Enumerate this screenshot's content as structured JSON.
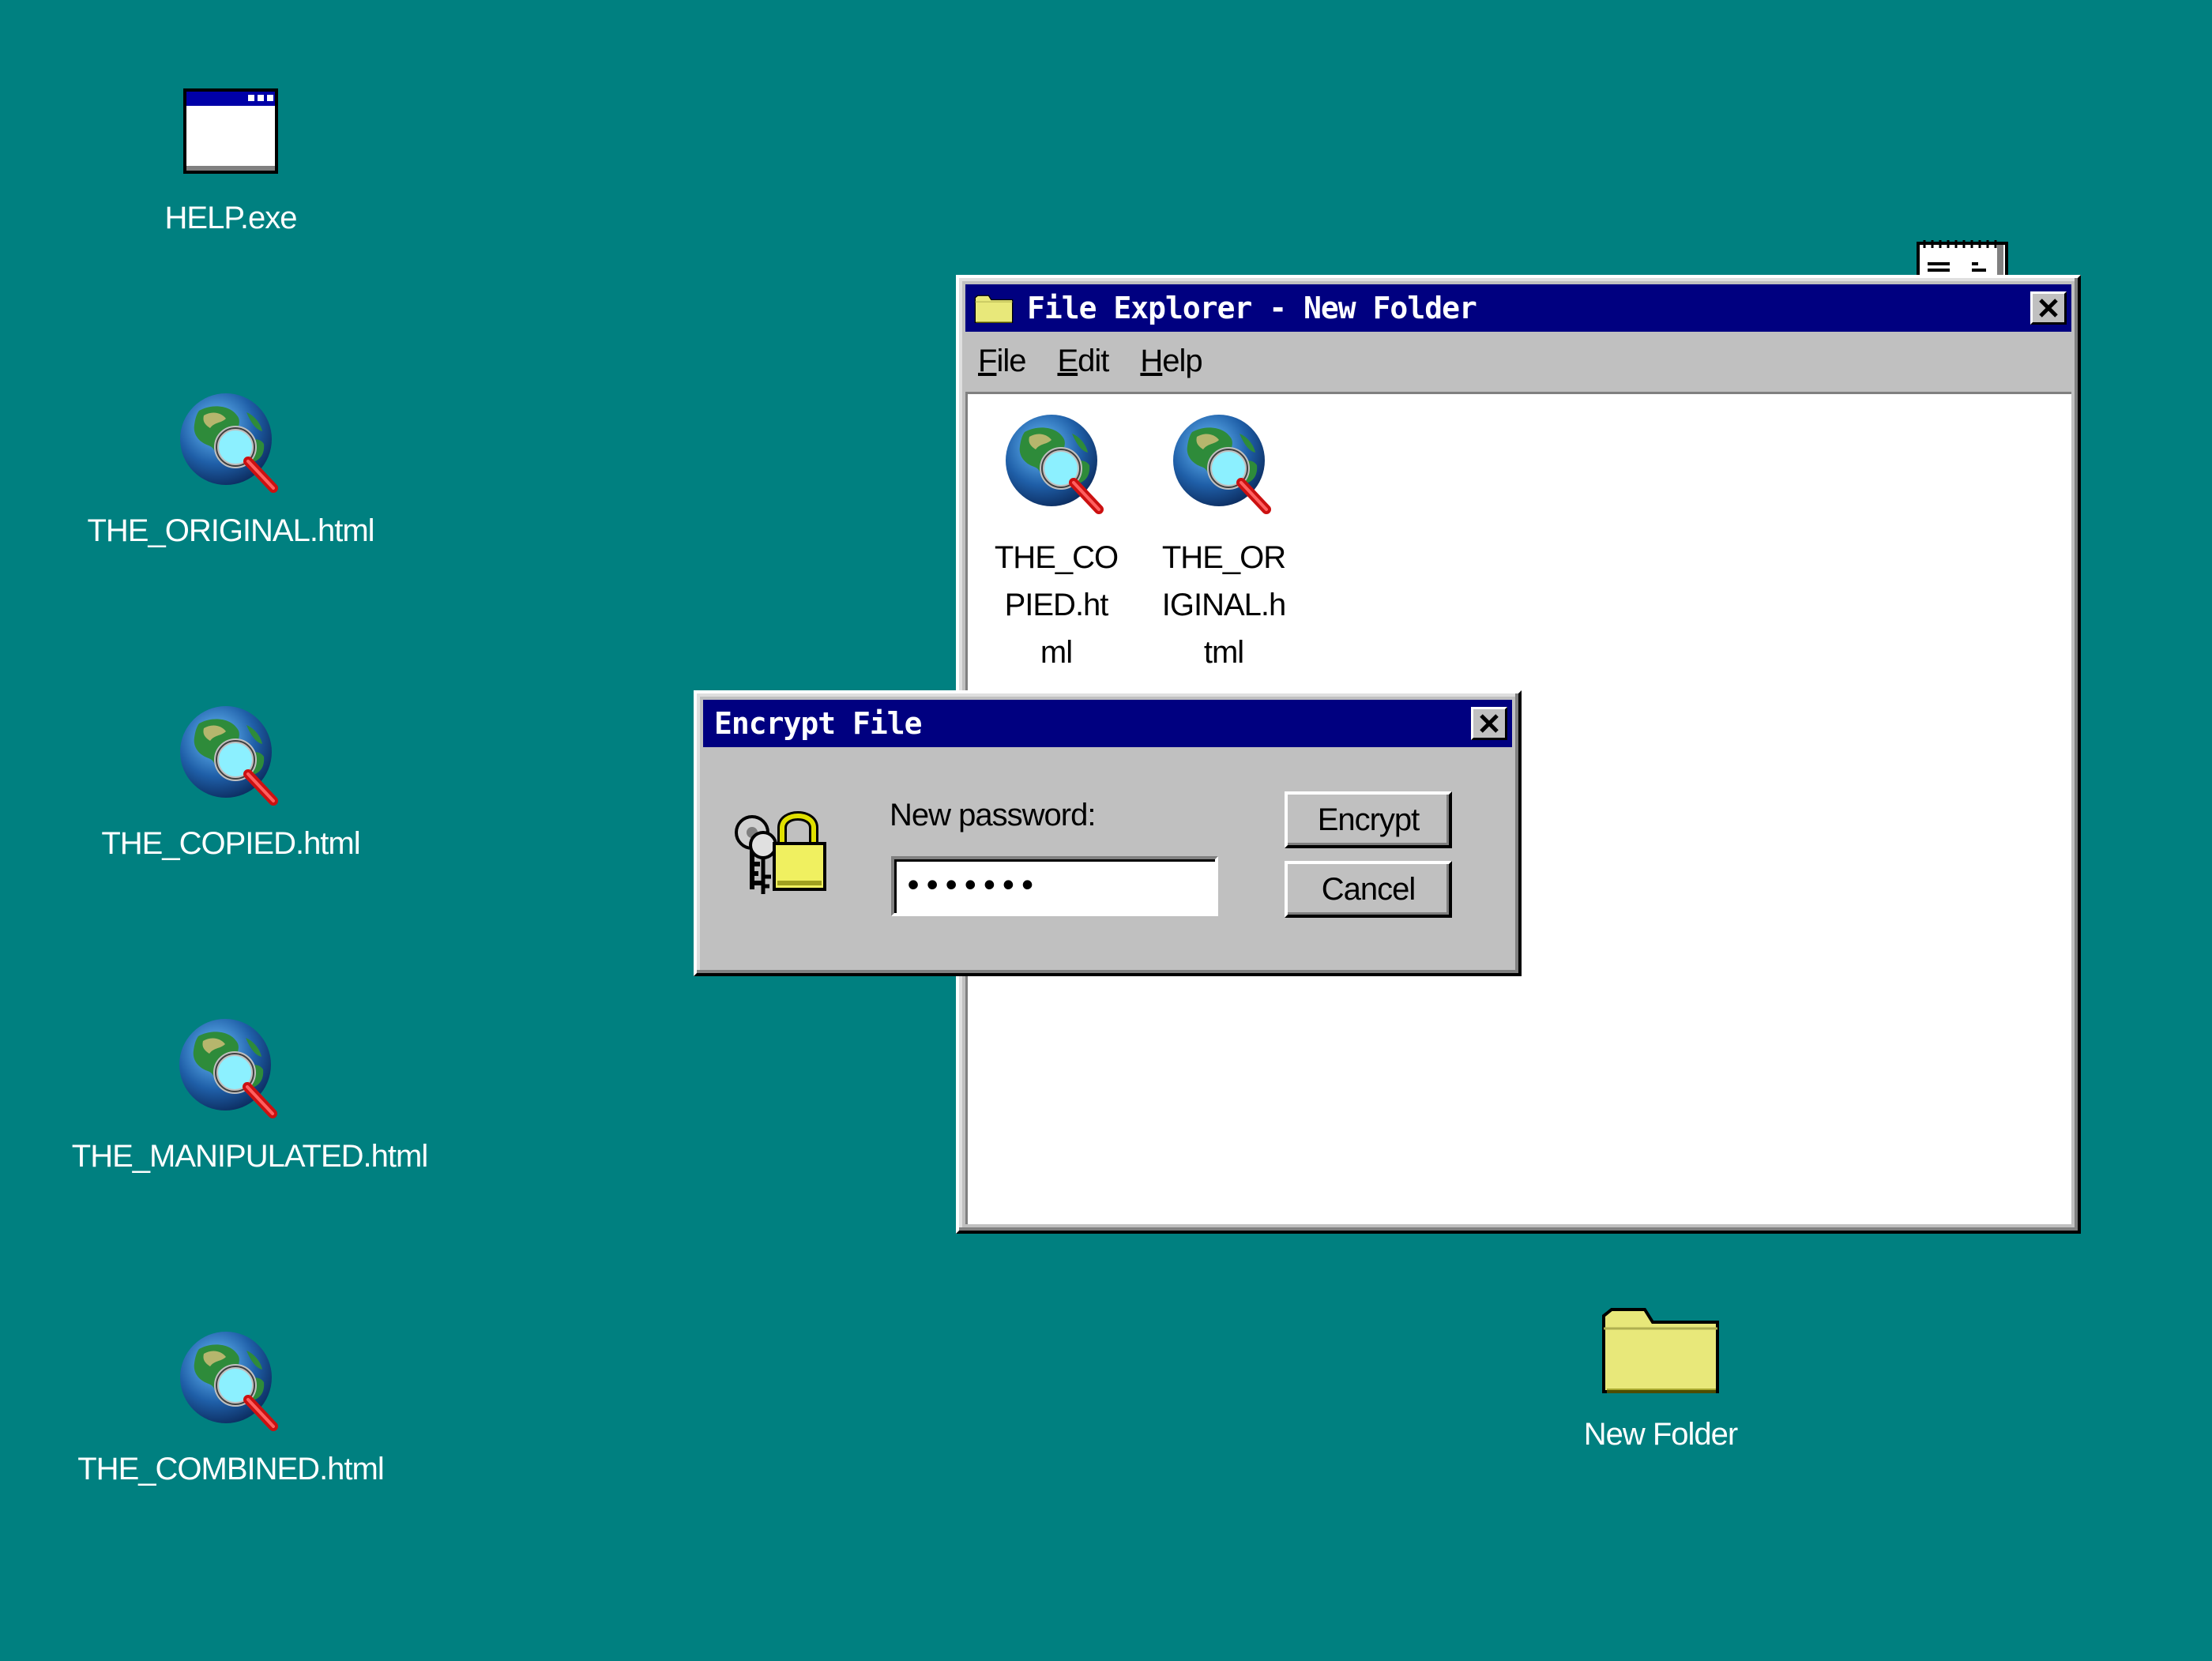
{
  "desktop": {
    "background_color": "#008080",
    "icons": [
      {
        "label": "HELP.exe",
        "icon": "window-app-icon"
      },
      {
        "label": "THE_ORIGINAL.html",
        "icon": "globe-magnifier-icon"
      },
      {
        "label": "THE_COPIED.html",
        "icon": "globe-magnifier-icon"
      },
      {
        "label": "THE_MANIPULATED.html",
        "icon": "globe-magnifier-icon"
      },
      {
        "label": "THE_COMBINED.html",
        "icon": "globe-magnifier-icon"
      },
      {
        "label": "New Folder",
        "icon": "folder-icon"
      }
    ]
  },
  "explorer": {
    "title": "File Explorer - New Folder",
    "title_icon": "folder-icon",
    "menu": [
      "File",
      "Edit",
      "Help"
    ],
    "files": [
      {
        "label": "THE_COPIED.html",
        "icon": "globe-magnifier-icon"
      },
      {
        "label": "THE_ORIGINAL.html",
        "icon": "globe-magnifier-icon"
      }
    ]
  },
  "dialog": {
    "title": "Encrypt File",
    "icon": "keys-padlock-icon",
    "password_label": "New password:",
    "password_value": "•••••••",
    "encrypt_label": "Encrypt",
    "cancel_label": "Cancel"
  },
  "colors": {
    "titlebar": "#000080",
    "window_face": "#c0c0c0",
    "folder": "#e8e87a"
  }
}
